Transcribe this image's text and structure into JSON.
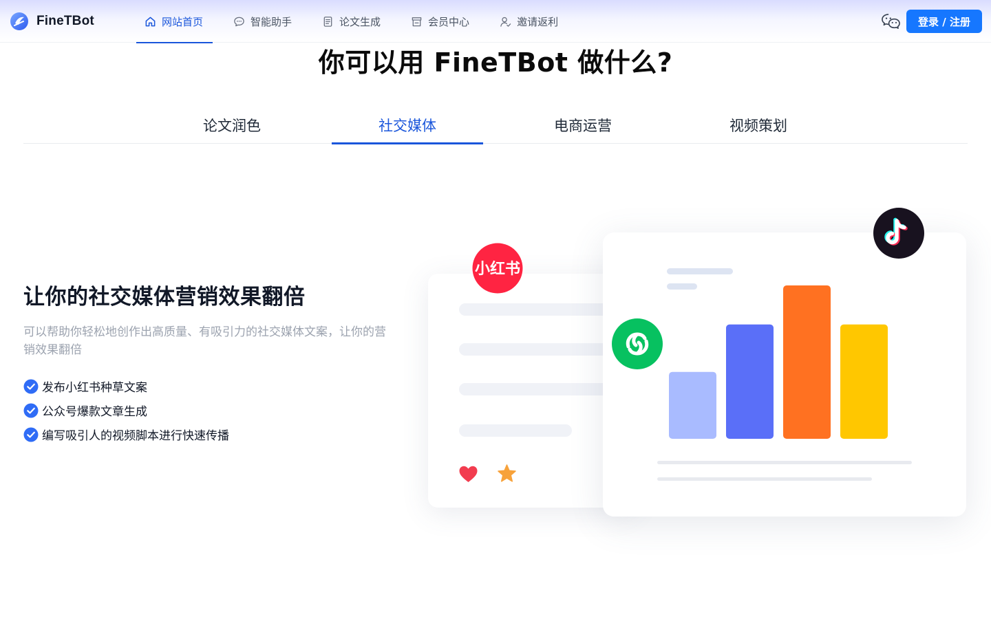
{
  "header": {
    "brand_name": "FineTBot",
    "nav": [
      {
        "label": "网站首页",
        "icon": "home-icon",
        "active": true
      },
      {
        "label": "智能助手",
        "icon": "chat-bubble-icon",
        "active": false
      },
      {
        "label": "论文生成",
        "icon": "document-icon",
        "active": false
      },
      {
        "label": "会员中心",
        "icon": "store-icon",
        "active": false
      },
      {
        "label": "邀请返利",
        "icon": "invite-user-icon",
        "active": false
      }
    ],
    "wechat_icon": "wechat-icon",
    "login_label": "登录 / 注册"
  },
  "main": {
    "title": "你可以用 FineTBot 做什么?",
    "tabs": [
      {
        "label": "论文润色",
        "active": false
      },
      {
        "label": "社交媒体",
        "active": true
      },
      {
        "label": "电商运营",
        "active": false
      },
      {
        "label": "视频策划",
        "active": false
      }
    ],
    "section": {
      "heading": "让你的社交媒体营销效果翻倍",
      "description": "可以帮助你轻松地创作出高质量、有吸引力的社交媒体文案，让你的营销效果翻倍",
      "features": [
        "发布小红书种草文案",
        "公众号爆款文章生成",
        "编写吸引人的视频脚本进行快速传播"
      ]
    },
    "illustration": {
      "badges": [
        {
          "name": "xiaohongshu-badge",
          "text": "小红书",
          "color": "#ff2442"
        },
        {
          "name": "tiktok-badge",
          "icon": "tiktok-icon",
          "color": "#111827"
        },
        {
          "name": "green-app-badge",
          "icon": "swirl-logo-icon",
          "color": "#07c160"
        }
      ],
      "reactions": [
        {
          "icon": "heart-icon",
          "color": "#f23c4f"
        },
        {
          "icon": "star-icon",
          "color": "#f7a23b"
        }
      ]
    }
  },
  "chart_data": {
    "type": "bar",
    "categories": [
      "",
      "",
      "",
      ""
    ],
    "values": [
      48,
      82,
      110,
      82
    ],
    "colors": [
      "#a9bbff",
      "#5a6ff8",
      "#ff7121",
      "#ffc700"
    ],
    "title": "",
    "xlabel": "",
    "ylabel": "",
    "ylim": [
      0,
      110
    ],
    "grid": false,
    "legend": "none"
  },
  "colors": {
    "accent": "#1a56db",
    "button": "#1677ff",
    "muted_text": "#9ca3af"
  }
}
